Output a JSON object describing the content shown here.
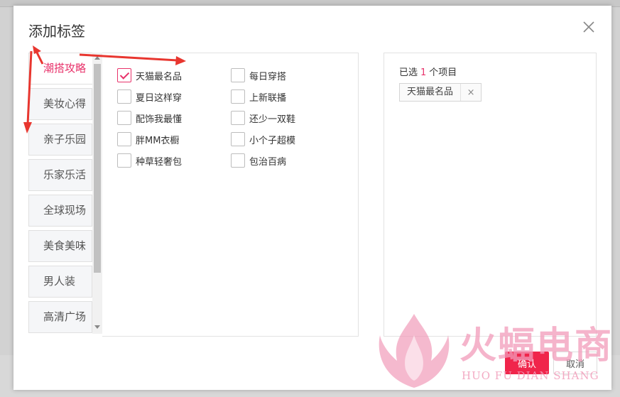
{
  "dialog": {
    "title": "添加标签",
    "close_icon": "close-icon"
  },
  "categories": [
    {
      "label": "潮搭攻略",
      "active": true
    },
    {
      "label": "美妆心得",
      "active": false
    },
    {
      "label": "亲子乐园",
      "active": false
    },
    {
      "label": "乐家乐活",
      "active": false
    },
    {
      "label": "全球现场",
      "active": false
    },
    {
      "label": "美食美味",
      "active": false
    },
    {
      "label": "男人装",
      "active": false
    },
    {
      "label": "高清广场",
      "active": false
    }
  ],
  "tags": [
    {
      "label": "天猫最名品",
      "checked": true
    },
    {
      "label": "每日穿搭",
      "checked": false
    },
    {
      "label": "夏日这样穿",
      "checked": false
    },
    {
      "label": "上新联播",
      "checked": false
    },
    {
      "label": "配饰我最懂",
      "checked": false
    },
    {
      "label": "还少一双鞋",
      "checked": false
    },
    {
      "label": "胖MM衣橱",
      "checked": false
    },
    {
      "label": "小个子超模",
      "checked": false
    },
    {
      "label": "种草轻奢包",
      "checked": false
    },
    {
      "label": "包治百病",
      "checked": false
    }
  ],
  "selected": {
    "prefix": "已选",
    "count": "1",
    "suffix": "个项目",
    "items": [
      {
        "label": "天猫最名品",
        "remove": "×"
      }
    ]
  },
  "buttons": {
    "confirm": "确认",
    "cancel": "取消"
  },
  "watermark": {
    "text": "火蝠电商",
    "sub": "HUO FU DIAN SHANG"
  },
  "colors": {
    "accent": "#e8336b",
    "confirm_bg": "#f0254b",
    "annotation": "#e8362f"
  }
}
